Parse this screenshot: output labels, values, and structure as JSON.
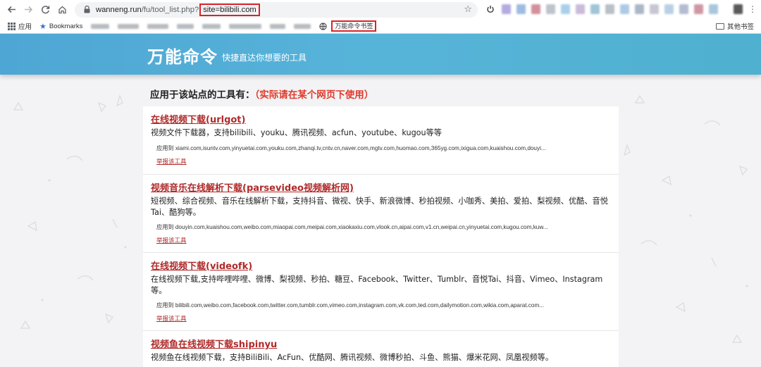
{
  "browser": {
    "url_host": "wanneng.run",
    "url_path": "/fu/tool_list.php?",
    "url_query": "site=bilibili.com",
    "bookmarks": {
      "apps_label": "应用",
      "bookmarks_label": "Bookmarks",
      "wanneng_label": "万能命令书签",
      "other_label": "其他书签"
    }
  },
  "header": {
    "title": "万能命令",
    "subtitle": "快捷直达你想要的工具"
  },
  "main": {
    "heading": "应用于该站点的工具有：",
    "heading_note": "（实际请在某个网页下使用）",
    "tools": [
      {
        "title": "在线视频下载(urlgot)",
        "desc": "视频文件下载器，支持bilibili、youku、腾讯视频、acfun、youtube、kugou等等",
        "sites": "应用到  xiami.com,isuntv.com,yinyuetai.com,youku.com,zhanqi.tv,cntv.cn,naver.com,mgtv.com,huomao.com,365yg.com,ixigua.com,kuaishou.com,douyi...",
        "report": "举报该工具"
      },
      {
        "title": "视频音乐在线解析下载(parsevideo视频解析网)",
        "desc": "短视频、综合视频、音乐在线解析下载，支持抖音、微视、快手、新浪微博、秒拍视频、小咖秀、美拍、爱拍、梨视频、优酷、音悦Tai、酷狗等。",
        "sites": "应用到  douyin.com,kuaishou.com,weibo.com,miaopai.com,meipai.com,xiaokaxiu.com,vlook.cn,aipai.com,v1.cn,weipai.cn,yinyuetai.com,kugou.com,kuw...",
        "report": "举报该工具"
      },
      {
        "title": "在线视频下载(videofk)",
        "desc": "在线视频下载,支持哔哩哔哩、微博、梨视频、秒拍、糖豆、Facebook、Twitter、Tumblr、音悦Tai、抖音、Vimeo、Instagram等。",
        "sites": "应用到  bilibili.com,weibo.com,facebook.com,twitter.com,tumblr.com,vimeo.com,instagram.com,vk.com,ted.com,dailymotion.com,wikia.com,aparat.com...",
        "report": "举报该工具"
      },
      {
        "title": "视频鱼在线视频下载shipinyu",
        "desc": "视频鱼在线视频下载，支持BiliBili、AcFun、优酷网、腾讯视频、微博秒拍、斗鱼、熊猫、爆米花网、凤凰视频等。",
        "sites": "",
        "report": ""
      }
    ]
  }
}
